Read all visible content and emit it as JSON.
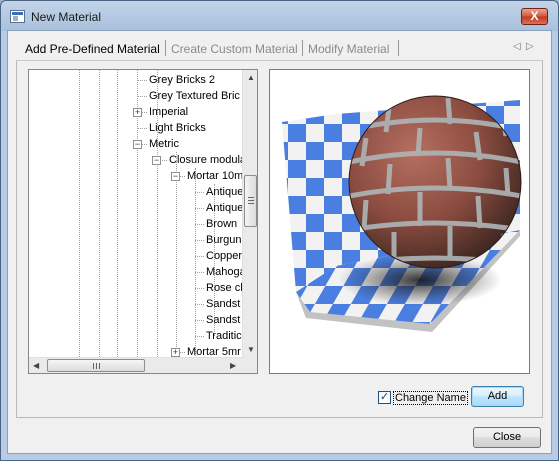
{
  "window": {
    "title": "New Material",
    "close_glyph": "X"
  },
  "tabs": [
    {
      "label": "Add Pre-Defined Material",
      "active": true
    },
    {
      "label": "Create Custom Material",
      "active": false
    },
    {
      "label": "Modify Material",
      "active": false
    }
  ],
  "tab_nav": {
    "prev": "◁",
    "next": "▷"
  },
  "tree": {
    "nodes": [
      {
        "label": "Grey Bricks 2",
        "level": 0
      },
      {
        "label": "Grey Textured Bric",
        "level": 0
      },
      {
        "label": "Imperial",
        "level": 0,
        "toggle": "+"
      },
      {
        "label": "Light Bricks",
        "level": 0
      },
      {
        "label": "Metric",
        "level": 0,
        "toggle": "−"
      },
      {
        "label": "Closure modula",
        "level": 1,
        "toggle": "−"
      },
      {
        "label": "Mortar 10m",
        "level": 2,
        "toggle": "−"
      },
      {
        "label": "Antique",
        "level": 3
      },
      {
        "label": "Antique",
        "level": 3
      },
      {
        "label": "Brown",
        "level": 3
      },
      {
        "label": "Burgun",
        "level": 3
      },
      {
        "label": "Copper",
        "level": 3
      },
      {
        "label": "Mahoga",
        "level": 3
      },
      {
        "label": "Rose cl",
        "level": 3
      },
      {
        "label": "Sandst",
        "level": 3
      },
      {
        "label": "Sandst",
        "level": 3
      },
      {
        "label": "Traditic",
        "level": 3
      },
      {
        "label": "Mortar 5mr",
        "level": 2,
        "toggle": "+"
      }
    ],
    "scroll_up": "▲",
    "scroll_down": "▼",
    "scroll_left": "◀",
    "scroll_right": "▶"
  },
  "preview": {
    "checker_color": "#4a7ee0",
    "brick_color": "#9a5547",
    "mortar_color": "#aeb5b7"
  },
  "options": {
    "change_name_label": "Change Name",
    "change_name_checked": true,
    "check_glyph": "✓"
  },
  "buttons": {
    "add": "Add",
    "close": "Close"
  }
}
